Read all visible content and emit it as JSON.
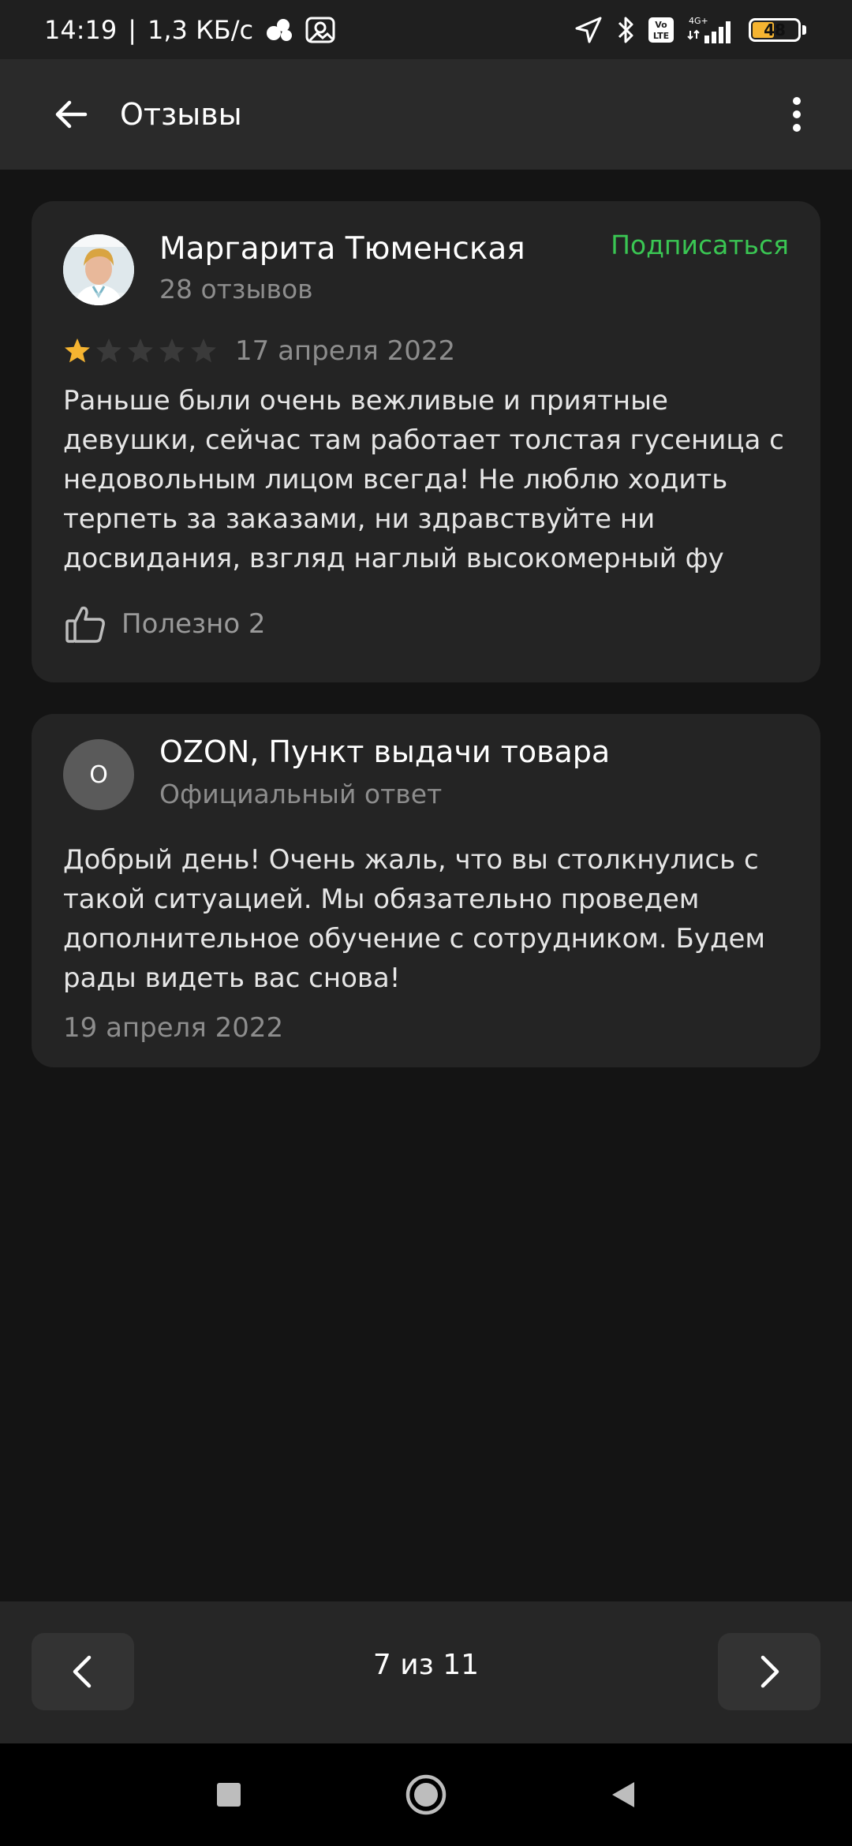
{
  "status_bar": {
    "time": "14:19",
    "speed": "1,3 КБ/с",
    "network": "4G+",
    "battery_level": "48",
    "battery_fraction": 0.48,
    "icons": [
      "location-icon",
      "bluetooth-icon",
      "volte-icon",
      "signal-icon",
      "battery-icon"
    ]
  },
  "app_bar": {
    "title": "Отзывы"
  },
  "review": {
    "author": "Маргарита Тюменская",
    "reviews_count": "28 отзывов",
    "subscribe_label": "Подписаться",
    "rating": 1,
    "rating_max": 5,
    "date": "17 апреля 2022",
    "text": "Раньше были очень вежливые и приятные девушки, сейчас там работает толстая гусеница с недовольным лицом всегда! Не люблю ходить терпеть за заказами, ни здравствуйте ни досвидания, взгляд наглый высокомерный фу",
    "useful_label": "Полезно 2"
  },
  "reply": {
    "avatar_letter": "О",
    "organization": "OZON, Пункт выдачи товара",
    "subtitle": "Официальный ответ",
    "text": "Добрый день! Очень жаль, что вы столкнулись с такой ситуацией. Мы обязательно проведем дополнительное обучение с сотрудником. Будем рады видеть вас снова!",
    "date": "19 апреля 2022"
  },
  "pager": {
    "counter": "7 из 11"
  },
  "colors": {
    "accent_green": "#3ac653",
    "star_filled": "#f5b431",
    "star_empty": "#3a3a3a"
  }
}
